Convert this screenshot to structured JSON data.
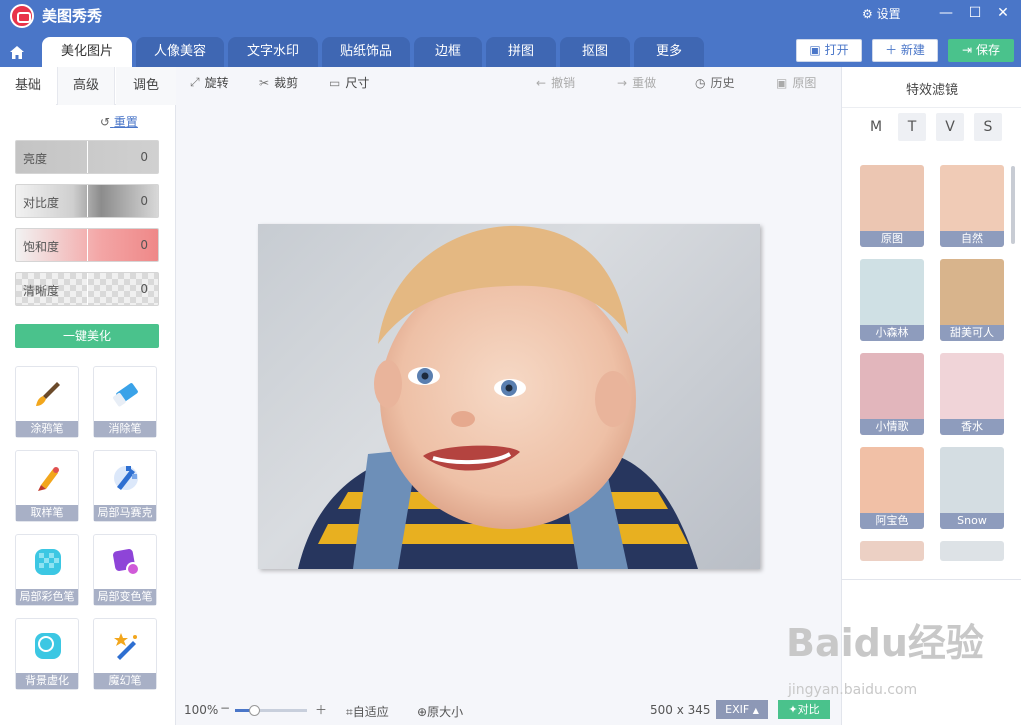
{
  "app": {
    "title": "美图秀秀",
    "settings_label": "设置"
  },
  "tabs": [
    "美化图片",
    "人像美容",
    "文字水印",
    "贴纸饰品",
    "边框",
    "拼图",
    "抠图",
    "更多"
  ],
  "top_buttons": {
    "open": "打开",
    "new": "新建",
    "save": "保存"
  },
  "left": {
    "tabs": [
      "基础",
      "高级",
      "调色"
    ],
    "reset": "重置",
    "sliders": [
      {
        "label": "亮度",
        "value": "0"
      },
      {
        "label": "对比度",
        "value": "0"
      },
      {
        "label": "饱和度",
        "value": "0"
      },
      {
        "label": "清晰度",
        "value": "0"
      }
    ],
    "one_key": "一键美化",
    "tools": [
      "涂鸦笔",
      "消除笔",
      "取样笔",
      "局部马赛克",
      "局部彩色笔",
      "局部变色笔",
      "背景虚化",
      "魔幻笔"
    ]
  },
  "toolbar": {
    "rotate": "旋转",
    "crop": "裁剪",
    "size": "尺寸",
    "undo": "撤销",
    "redo": "重做",
    "history": "历史",
    "original": "原图"
  },
  "bottom": {
    "zoom": "100%",
    "fit": "自适应",
    "actual": "原大小",
    "dims": "500 x 345",
    "exif": "EXIF",
    "compare": "对比"
  },
  "right": {
    "title": "特效滤镜",
    "mtabs": [
      "M",
      "T",
      "V",
      "S"
    ],
    "filters": [
      "原图",
      "自然",
      "小森林",
      "甜美可人",
      "小情歌",
      "香水",
      "阿宝色",
      "Snow"
    ]
  },
  "watermark": {
    "main": "Baidu经验",
    "sub": "jingyan.baidu.com"
  },
  "colors": {
    "accent": "#4a76c8",
    "green": "#4ac28c"
  }
}
